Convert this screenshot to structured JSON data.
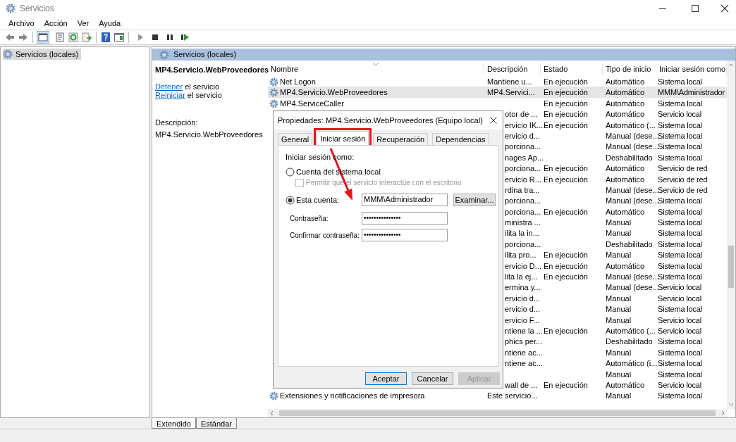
{
  "window": {
    "title": "Servicios"
  },
  "menu": [
    {
      "label": "Archivo"
    },
    {
      "label": "Acción"
    },
    {
      "label": "Ver"
    },
    {
      "label": "Ayuda"
    }
  ],
  "tree": [
    {
      "label": "Servicios (locales)",
      "selected": true
    }
  ],
  "pane_header": "Servicios (locales)",
  "details": {
    "service_name": "MP4.Servicio.WebProveedores",
    "actions": [
      {
        "link": "Detener",
        "text": "el servicio"
      },
      {
        "link": "Reiniciar",
        "text": "el servicio"
      }
    ],
    "description_label": "Descripción:",
    "description": "MP4.Servicio.WebProveedores"
  },
  "table": {
    "columns": [
      "Nombre",
      "Descripción",
      "Estado",
      "Tipo de inicio",
      "Iniciar sesión como"
    ],
    "rows": [
      {
        "name": "Net Logon",
        "description": "Mantiene u...",
        "status": "En ejecución",
        "startup": "Automático",
        "logon": "Sistema local",
        "selected": false
      },
      {
        "name": "MP4.Servicio.WebProveedores",
        "description": "MP4.Servici...",
        "status": "En ejecución",
        "startup": "Automático",
        "logon": "MMM\\Administrador",
        "selected": true
      },
      {
        "name": "MP4.ServiceCaller",
        "status": "En ejecución",
        "startup": "Automático",
        "logon": "Sistema local",
        "selected": false
      },
      {
        "description": "otor de ...",
        "status": "En ejecución",
        "startup": "Automático",
        "logon": "Servicio local",
        "selected": false
      },
      {
        "description": "ervicio IK...",
        "status": "En ejecución",
        "startup": "Automático (...",
        "logon": "Sistema local",
        "selected": false
      },
      {
        "description": "ervicio d...",
        "startup": "Manual (dese...",
        "logon": "Sistema local",
        "selected": false
      },
      {
        "description": "porciona...",
        "startup": "Manual (dese...",
        "logon": "Sistema local",
        "selected": false
      },
      {
        "description": "nages Ap...",
        "startup": "Deshabilitado",
        "logon": "Sistema local",
        "selected": false
      },
      {
        "description": "porciona...",
        "status": "En ejecución",
        "startup": "Automático",
        "logon": "Servicio de red",
        "selected": false
      },
      {
        "description": "ervicio R...",
        "status": "En ejecución",
        "startup": "Automático",
        "logon": "Servicio de red",
        "selected": false
      },
      {
        "description": "rdina tra...",
        "startup": "Manual (dese...",
        "logon": "Servicio de red",
        "selected": false
      },
      {
        "description": "porciona...",
        "startup": "Manual (dese...",
        "logon": "Sistema local",
        "selected": false
      },
      {
        "description": "porciona...",
        "status": "En ejecución",
        "startup": "Automático",
        "logon": "Sistema local",
        "selected": false
      },
      {
        "description": "ministra ...",
        "startup": "Manual",
        "logon": "Sistema local",
        "selected": false
      },
      {
        "description": "ilita la in...",
        "startup": "Manual",
        "logon": "Sistema local",
        "selected": false
      },
      {
        "description": "porciona...",
        "startup": "Deshabilitado",
        "logon": "Sistema local",
        "selected": false
      },
      {
        "description": "ilita pro...",
        "status": "En ejecución",
        "startup": "Manual",
        "logon": "Sistema local",
        "selected": false
      },
      {
        "description": "ervicio D...",
        "status": "En ejecución",
        "startup": "Automático",
        "logon": "Sistema local",
        "selected": false
      },
      {
        "description": "lita la ej...",
        "status": "En ejecución",
        "startup": "Manual (dese...",
        "logon": "Sistema local",
        "selected": false
      },
      {
        "description": "ermina y...",
        "startup": "Manual (dese...",
        "logon": "Servicio local",
        "selected": false
      },
      {
        "description": "ervicio d...",
        "startup": "Manual",
        "logon": "Servicio local",
        "selected": false
      },
      {
        "description": "ervicio d...",
        "startup": "Manual",
        "logon": "Sistema local",
        "selected": false
      },
      {
        "description": "ervicio F...",
        "startup": "Manual",
        "logon": "Servicio local",
        "selected": false
      },
      {
        "description": "ntiene la ...",
        "status": "En ejecución",
        "startup": "Automático (...",
        "logon": "Servicio local",
        "selected": false
      },
      {
        "description": "phics per...",
        "startup": "Deshabilitado",
        "logon": "Sistema local",
        "selected": false
      },
      {
        "description": "ntiene ac...",
        "startup": "Manual",
        "logon": "Sistema local",
        "selected": false
      },
      {
        "description": "ntiene ac...",
        "startup": "Automático (i...",
        "logon": "Sistema local",
        "selected": false
      },
      {
        "startup": "Manual",
        "logon": "Sistema local",
        "selected": false
      },
      {
        "description": "wall de ...",
        "status": "En ejecución",
        "startup": "Automático",
        "logon": "Servicio local",
        "selected": false
      },
      {
        "name": "Extensiones y notificaciones de impresora",
        "description": "Este servicio...",
        "startup": "Manual",
        "logon": "Sistema local",
        "selected": false
      }
    ]
  },
  "view_tabs": [
    {
      "label": "Extendido",
      "selected": true
    },
    {
      "label": "Estándar",
      "selected": false
    }
  ],
  "dialog": {
    "title": "Propiedades: MP4.Servicio.WebProveedores (Equipo local)",
    "tabs": [
      {
        "label": "General",
        "selected": false
      },
      {
        "label": "Iniciar sesión",
        "selected": true
      },
      {
        "label": "Recuperación",
        "selected": false
      },
      {
        "label": "Dependencias",
        "selected": false
      }
    ],
    "section_label": "Iniciar sesión como:",
    "local_account": {
      "label": "Cuenta del sistema local",
      "selected": false
    },
    "interact": {
      "label": "Permitir que el servicio interactúe con el escritorio",
      "checked": false,
      "disabled": true
    },
    "this_account": {
      "label": "Esta cuenta:",
      "selected": true,
      "value": "MMM\\Administrador"
    },
    "browse_button": "Examinar...",
    "password": {
      "label": "Contraseña:",
      "value": "•••••••••••••••"
    },
    "confirm_password": {
      "label": "Confirmar contraseña:",
      "value": "•••••••••••••••"
    },
    "buttons": [
      {
        "label": "Aceptar",
        "disabled": false
      },
      {
        "label": "Cancelar",
        "disabled": false
      },
      {
        "label": "Aplicar",
        "disabled": true
      }
    ]
  }
}
